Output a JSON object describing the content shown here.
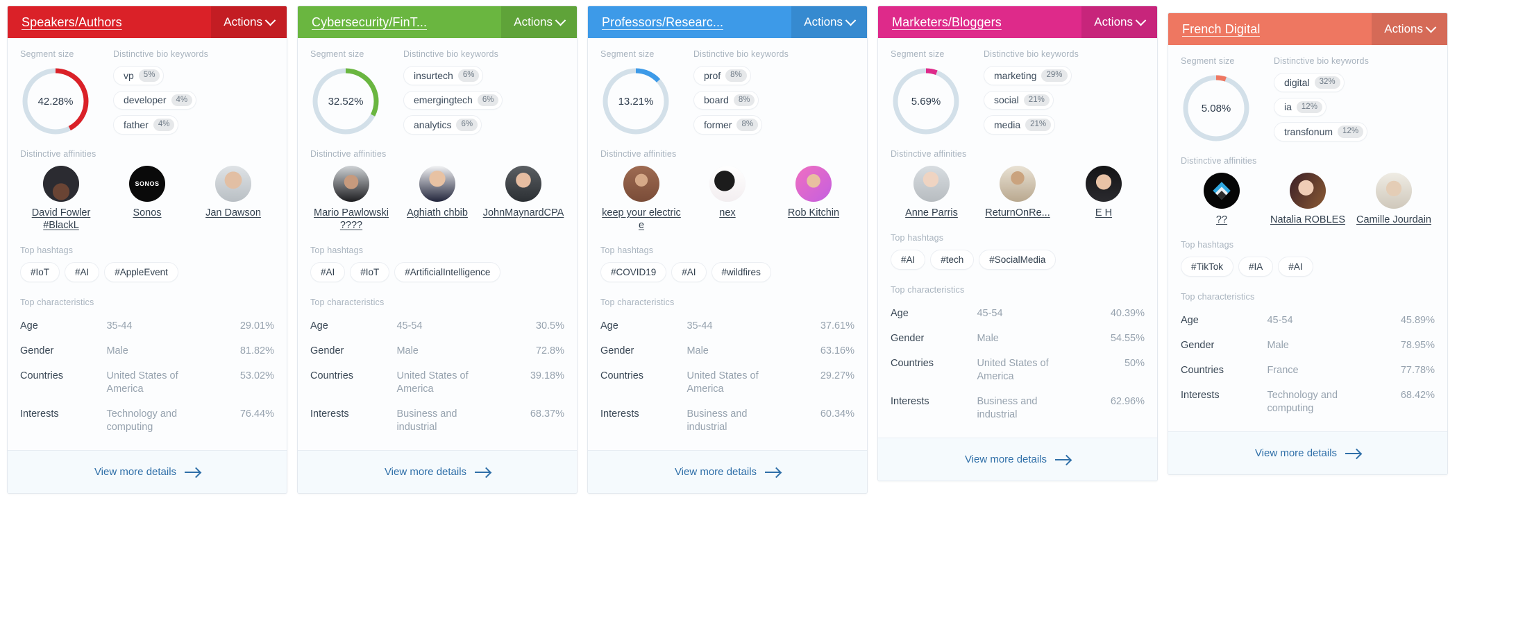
{
  "labels": {
    "segment_size": "Segment size",
    "bio_keywords": "Distinctive bio keywords",
    "affinities": "Distinctive affinities",
    "hashtags": "Top hashtags",
    "characteristics": "Top characteristics",
    "actions": "Actions",
    "view_more": "View more details"
  },
  "colors": {
    "red": "#da2128",
    "green": "#6ab640",
    "blue": "#3d9ae8",
    "pink": "#de2a8a",
    "orange": "#ee7761",
    "donut_track": "#d3e0e9",
    "link": "#2f6fa8"
  },
  "cards": [
    {
      "title": "Speakers/Authors",
      "color": "#da2128",
      "offset": false,
      "segment_size": "42.28%",
      "segment_value": 42.28,
      "keywords": [
        {
          "word": "vp",
          "pct": "5%"
        },
        {
          "word": "developer",
          "pct": "4%"
        },
        {
          "word": "father",
          "pct": "4%"
        }
      ],
      "affinities": [
        {
          "name": "David Fowler #BlackL",
          "avatar": "photo-man-dark-tshirt"
        },
        {
          "name": "Sonos",
          "avatar": "sonos-logo-black"
        },
        {
          "name": "Jan Dawson",
          "avatar": "photo-man-suit"
        }
      ],
      "hashtags": [
        "#IoT",
        "#AI",
        "#AppleEvent"
      ],
      "characteristics": [
        {
          "key": "Age",
          "value": "35-44",
          "pct": "29.01%"
        },
        {
          "key": "Gender",
          "value": "Male",
          "pct": "81.82%"
        },
        {
          "key": "Countries",
          "value": "United States of America",
          "pct": "53.02%"
        },
        {
          "key": "Interests",
          "value": "Technology and computing",
          "pct": "76.44%"
        }
      ]
    },
    {
      "title": "Cybersecurity/FinT...",
      "color": "#6ab640",
      "offset": false,
      "segment_size": "32.52%",
      "segment_value": 32.52,
      "keywords": [
        {
          "word": "insurtech",
          "pct": "6%"
        },
        {
          "word": "emergingtech",
          "pct": "6%"
        },
        {
          "word": "analytics",
          "pct": "6%"
        }
      ],
      "affinities": [
        {
          "name": "Mario Pawlowski ????",
          "avatar": "photo-man-dark-jacket"
        },
        {
          "name": "Aghiath chbib",
          "avatar": "photo-man-red-tie"
        },
        {
          "name": "JohnMaynardCPA",
          "avatar": "photo-man-glasses-tie"
        }
      ],
      "hashtags": [
        "#AI",
        "#IoT",
        "#ArtificialIntelligence"
      ],
      "characteristics": [
        {
          "key": "Age",
          "value": "45-54",
          "pct": "30.5%"
        },
        {
          "key": "Gender",
          "value": "Male",
          "pct": "72.8%"
        },
        {
          "key": "Countries",
          "value": "United States of America",
          "pct": "39.18%"
        },
        {
          "key": "Interests",
          "value": "Business and industrial",
          "pct": "68.37%"
        }
      ]
    },
    {
      "title": "Professors/Researc...",
      "color": "#3d9ae8",
      "offset": false,
      "segment_size": "13.21%",
      "segment_value": 13.21,
      "keywords": [
        {
          "word": "prof",
          "pct": "8%"
        },
        {
          "word": "board",
          "pct": "8%"
        },
        {
          "word": "former",
          "pct": "8%"
        }
      ],
      "affinities": [
        {
          "name": "keep your electric e",
          "avatar": "photo-man-brick-wall"
        },
        {
          "name": "nex",
          "avatar": "photo-bw-abstract"
        },
        {
          "name": "Rob Kitchin",
          "avatar": "photo-man-pink-bg"
        }
      ],
      "hashtags": [
        "#COVID19",
        "#AI",
        "#wildfires"
      ],
      "characteristics": [
        {
          "key": "Age",
          "value": "35-44",
          "pct": "37.61%"
        },
        {
          "key": "Gender",
          "value": "Male",
          "pct": "63.16%"
        },
        {
          "key": "Countries",
          "value": "United States of America",
          "pct": "29.27%"
        },
        {
          "key": "Interests",
          "value": "Business and industrial",
          "pct": "60.34%"
        }
      ]
    },
    {
      "title": "Marketers/Bloggers",
      "color": "#de2a8a",
      "offset": false,
      "segment_size": "5.69%",
      "segment_value": 5.69,
      "keywords": [
        {
          "word": "marketing",
          "pct": "29%"
        },
        {
          "word": "social",
          "pct": "21%"
        },
        {
          "word": "media",
          "pct": "21%"
        }
      ],
      "affinities": [
        {
          "name": "Anne Parris",
          "avatar": "photo-woman-glasses-mug"
        },
        {
          "name": "ReturnOnRe...",
          "avatar": "photo-man-vest"
        },
        {
          "name": "E H",
          "avatar": "photo-woman-dark-hair"
        }
      ],
      "hashtags": [
        "#AI",
        "#tech",
        "#SocialMedia"
      ],
      "characteristics": [
        {
          "key": "Age",
          "value": "45-54",
          "pct": "40.39%"
        },
        {
          "key": "Gender",
          "value": "Male",
          "pct": "54.55%"
        },
        {
          "key": "Countries",
          "value": "United States of America",
          "pct": "50%"
        },
        {
          "key": "Interests",
          "value": "Business and industrial",
          "pct": "62.96%"
        }
      ]
    },
    {
      "title": "French Digital",
      "color": "#ee7761",
      "offset": true,
      "segment_size": "5.08%",
      "segment_value": 5.08,
      "keywords": [
        {
          "word": "digital",
          "pct": "32%"
        },
        {
          "word": "ia",
          "pct": "12%"
        },
        {
          "word": "transfonum",
          "pct": "12%"
        }
      ],
      "affinities": [
        {
          "name": "??",
          "avatar": "frenchweb-logo-black"
        },
        {
          "name": "Natalia ROBLES",
          "avatar": "photo-woman-smiling"
        },
        {
          "name": "Camille Jourdain",
          "avatar": "photo-man-beard-glasses"
        }
      ],
      "hashtags": [
        "#TikTok",
        "#IA",
        "#AI"
      ],
      "characteristics": [
        {
          "key": "Age",
          "value": "45-54",
          "pct": "45.89%"
        },
        {
          "key": "Gender",
          "value": "Male",
          "pct": "78.95%"
        },
        {
          "key": "Countries",
          "value": "France",
          "pct": "77.78%"
        },
        {
          "key": "Interests",
          "value": "Technology and computing",
          "pct": "68.42%"
        }
      ]
    }
  ]
}
